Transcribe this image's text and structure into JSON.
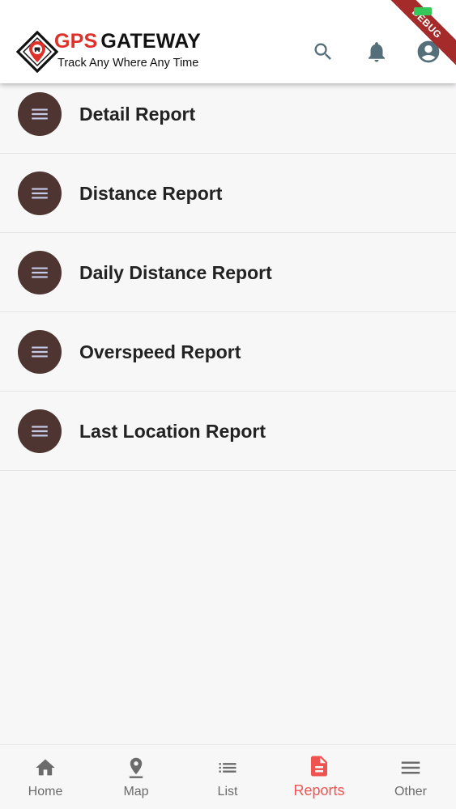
{
  "appbar": {
    "logo_title_gps": "GPS",
    "logo_title_gateway": "GATEWAY",
    "logo_tagline": "Track Any Where Any Time",
    "debug_ribbon": "DEBUG",
    "actions": [
      {
        "icon": "search-icon"
      },
      {
        "icon": "bell-icon"
      },
      {
        "icon": "account-circle-icon"
      }
    ]
  },
  "reports": [
    {
      "label": "Detail Report",
      "icon": "menu-icon"
    },
    {
      "label": "Distance Report",
      "icon": "menu-icon"
    },
    {
      "label": "Daily Distance Report",
      "icon": "menu-icon"
    },
    {
      "label": "Overspeed Report",
      "icon": "menu-icon"
    },
    {
      "label": "Last Location Report",
      "icon": "menu-icon"
    }
  ],
  "bottom_nav": {
    "active": "Reports",
    "items": [
      {
        "label": "Home",
        "icon": "home-icon"
      },
      {
        "label": "Map",
        "icon": "map-pin-icon"
      },
      {
        "label": "List",
        "icon": "list-icon"
      },
      {
        "label": "Reports",
        "icon": "document-icon"
      },
      {
        "label": "Other",
        "icon": "hamburger-icon"
      }
    ]
  },
  "colors": {
    "brand_red": "#e0302a",
    "appbar_icon": "#546e7a",
    "avatar_bg": "#4e3531",
    "avatar_icon": "#c5cae9",
    "nav_active": "#ef5350",
    "nav_inactive": "#6b6b6b",
    "background": "#f8f7f8"
  }
}
